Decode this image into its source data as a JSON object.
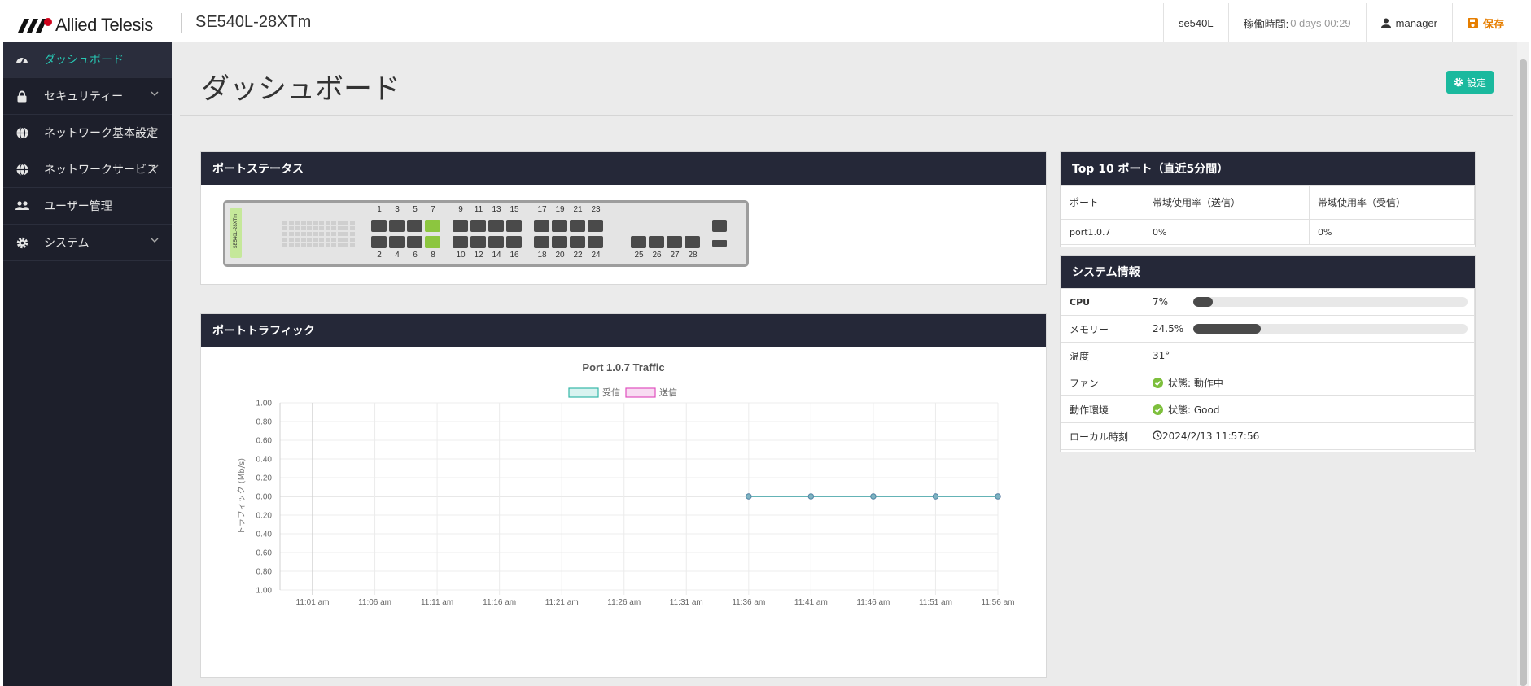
{
  "header": {
    "brand": "Allied Telesis",
    "model": "SE540L-28XTm",
    "hostname": "se540L",
    "uptime_label": "稼働時間:",
    "uptime_value": "0 days 00:29",
    "user": "manager",
    "save_label": "保存"
  },
  "sidebar": {
    "items": [
      {
        "label": "ダッシュボード",
        "icon": "gauge-icon"
      },
      {
        "label": "セキュリティー",
        "icon": "lock-icon"
      },
      {
        "label": "ネットワーク基本設定",
        "icon": "globe-icon"
      },
      {
        "label": "ネットワークサービス",
        "icon": "globe-icon"
      },
      {
        "label": "ユーザー管理",
        "icon": "users-icon"
      },
      {
        "label": "システム",
        "icon": "gear-icon"
      }
    ]
  },
  "main": {
    "title": "ダッシュボード",
    "settings_label": "設定",
    "port_status": {
      "title": "ポートステータス",
      "device_label": "SE540L-28XTm",
      "top_numbers": [
        "1",
        "3",
        "5",
        "7",
        "9",
        "11",
        "13",
        "15",
        "17",
        "19",
        "21",
        "23"
      ],
      "bottom_numbers": [
        "2",
        "4",
        "6",
        "8",
        "10",
        "12",
        "14",
        "16",
        "18",
        "20",
        "22",
        "24",
        "25",
        "26",
        "27",
        "28"
      ],
      "active_ports": [
        7,
        8
      ],
      "colors": {
        "up": "#8cc63f",
        "down": "#4a4a4a"
      }
    },
    "traffic": {
      "title": "ポートトラフィック"
    },
    "top10": {
      "title": "Top 10 ポート（直近5分間）",
      "headers": [
        "ポート",
        "帯域使用率（送信）",
        "帯域使用率（受信）"
      ],
      "rows": [
        [
          "port1.0.7",
          "0%",
          "0%"
        ]
      ]
    },
    "system_info": {
      "title": "システム情報",
      "cpu_label": "CPU",
      "cpu_value": "7%",
      "cpu_fraction": 0.07,
      "memory_label": "メモリー",
      "memory_value": "24.5%",
      "memory_fraction": 0.245,
      "temp_label": "温度",
      "temp_value": "31°",
      "fan_label": "ファン",
      "fan_value": "状態: 動作中",
      "env_label": "動作環境",
      "env_value": "状態: Good",
      "time_label": "ローカル時刻",
      "time_value": "2024/2/13 11:57:56"
    }
  },
  "chart_data": {
    "type": "line",
    "title": "Port 1.0.7 Traffic",
    "ylabel": "トラフィック (Mb/s)",
    "xlabel": "",
    "x": [
      "11:01 am",
      "11:06 am",
      "11:11 am",
      "11:16 am",
      "11:21 am",
      "11:26 am",
      "11:31 am",
      "11:36 am",
      "11:41 am",
      "11:46 am",
      "11:51 am",
      "11:56 am"
    ],
    "y_ticks": [
      "1.00",
      "0.80",
      "0.60",
      "0.40",
      "0.20",
      "0.00",
      "0.20",
      "0.40",
      "0.60",
      "0.80",
      "1.00"
    ],
    "ylim": [
      -1,
      1
    ],
    "series": [
      {
        "name": "受信",
        "color": "#36b7a8",
        "values": [
          null,
          null,
          null,
          null,
          null,
          null,
          null,
          0,
          0,
          0,
          0,
          0
        ]
      },
      {
        "name": "送信",
        "color": "#e04fbf",
        "values": [
          null,
          null,
          null,
          null,
          null,
          null,
          null,
          0,
          0,
          0,
          0,
          0
        ]
      }
    ],
    "legend": "top-center",
    "grid": true
  }
}
